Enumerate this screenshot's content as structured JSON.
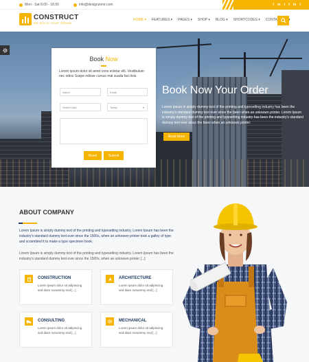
{
  "topbar": {
    "hours": "Mon - Sat 8.00 - 18.00",
    "email": "info@dexignzone.com",
    "social": [
      "f",
      "in",
      "t",
      "f",
      "in",
      "t"
    ]
  },
  "header": {
    "logo_title": "CONSTRUCT",
    "logo_tagline": "WE BUILD YOUR DREAM",
    "nav": [
      "HOME ▾",
      "FEATURES ▾",
      "PAGES ▾",
      "SHOP ▾",
      "BLOG ▾",
      "SHORTCODES ▾",
      "CONTACT US ▾"
    ]
  },
  "hero": {
    "title": "Book Now Your Order",
    "text": "Lorem Ipsum is simply dummy text of the printing and typesetting industry has been the industry's standard dummy text ever since the been when an unknown printer. Lorem Ipsum is simply dummy text of the printing and typesetting industry has been the industry's standard dummy text ever since the been when an unknown printer.",
    "button": "Read More"
  },
  "form": {
    "title_part1": "Book ",
    "title_part2": "Now",
    "description": "Lorem ipsum dolor sit amet cons ectetur elit. Vestibulum nec odios Suspe ndisse cursus mal suada faci lisis.",
    "name_placeholder": "Name",
    "email_placeholder": "Email",
    "date_placeholder": "Select Date",
    "select_value": "Today",
    "reset": "Reset",
    "submit": "Submit"
  },
  "about": {
    "title": "ABOUT COMPANY",
    "p1": "Lorem Ipsum is simply dummy text of the printing and typesetting industry. Lorem Ipsum has been the industry's standard dummy text ever since the 1500s, when an unknown printer took a galley of type and scrambled it to make a type specimen book.",
    "p2": "Lorem Ipsum is simply dummy text of the printing and typesetting industry. Lorem Ipsum has been the industry's standard dummy text ever since the 1500s, when an unknown printer [...]"
  },
  "services": [
    {
      "name": "CONSTRUCTION",
      "desc": "Lorem ipsum dolor sit adipiscing sed diam nonummy end [...]",
      "icon": "building-icon"
    },
    {
      "name": "ARCHITECTURE",
      "desc": "Lorem ipsum dolor sit adipiscing sed diam nonummy end [...]",
      "icon": "compass-icon"
    },
    {
      "name": "CONSULTING",
      "desc": "Lorem ipsum dolor sit adipiscing sed diam nonummy end [...]",
      "icon": "truck-icon"
    },
    {
      "name": "MECHANICAL",
      "desc": "Lorem ipsum dolor sit adipiscing sed diam nonummy end [...]",
      "icon": "gear-icon"
    }
  ],
  "colors": {
    "accent": "#f5b400",
    "navy": "#1f3b62"
  }
}
